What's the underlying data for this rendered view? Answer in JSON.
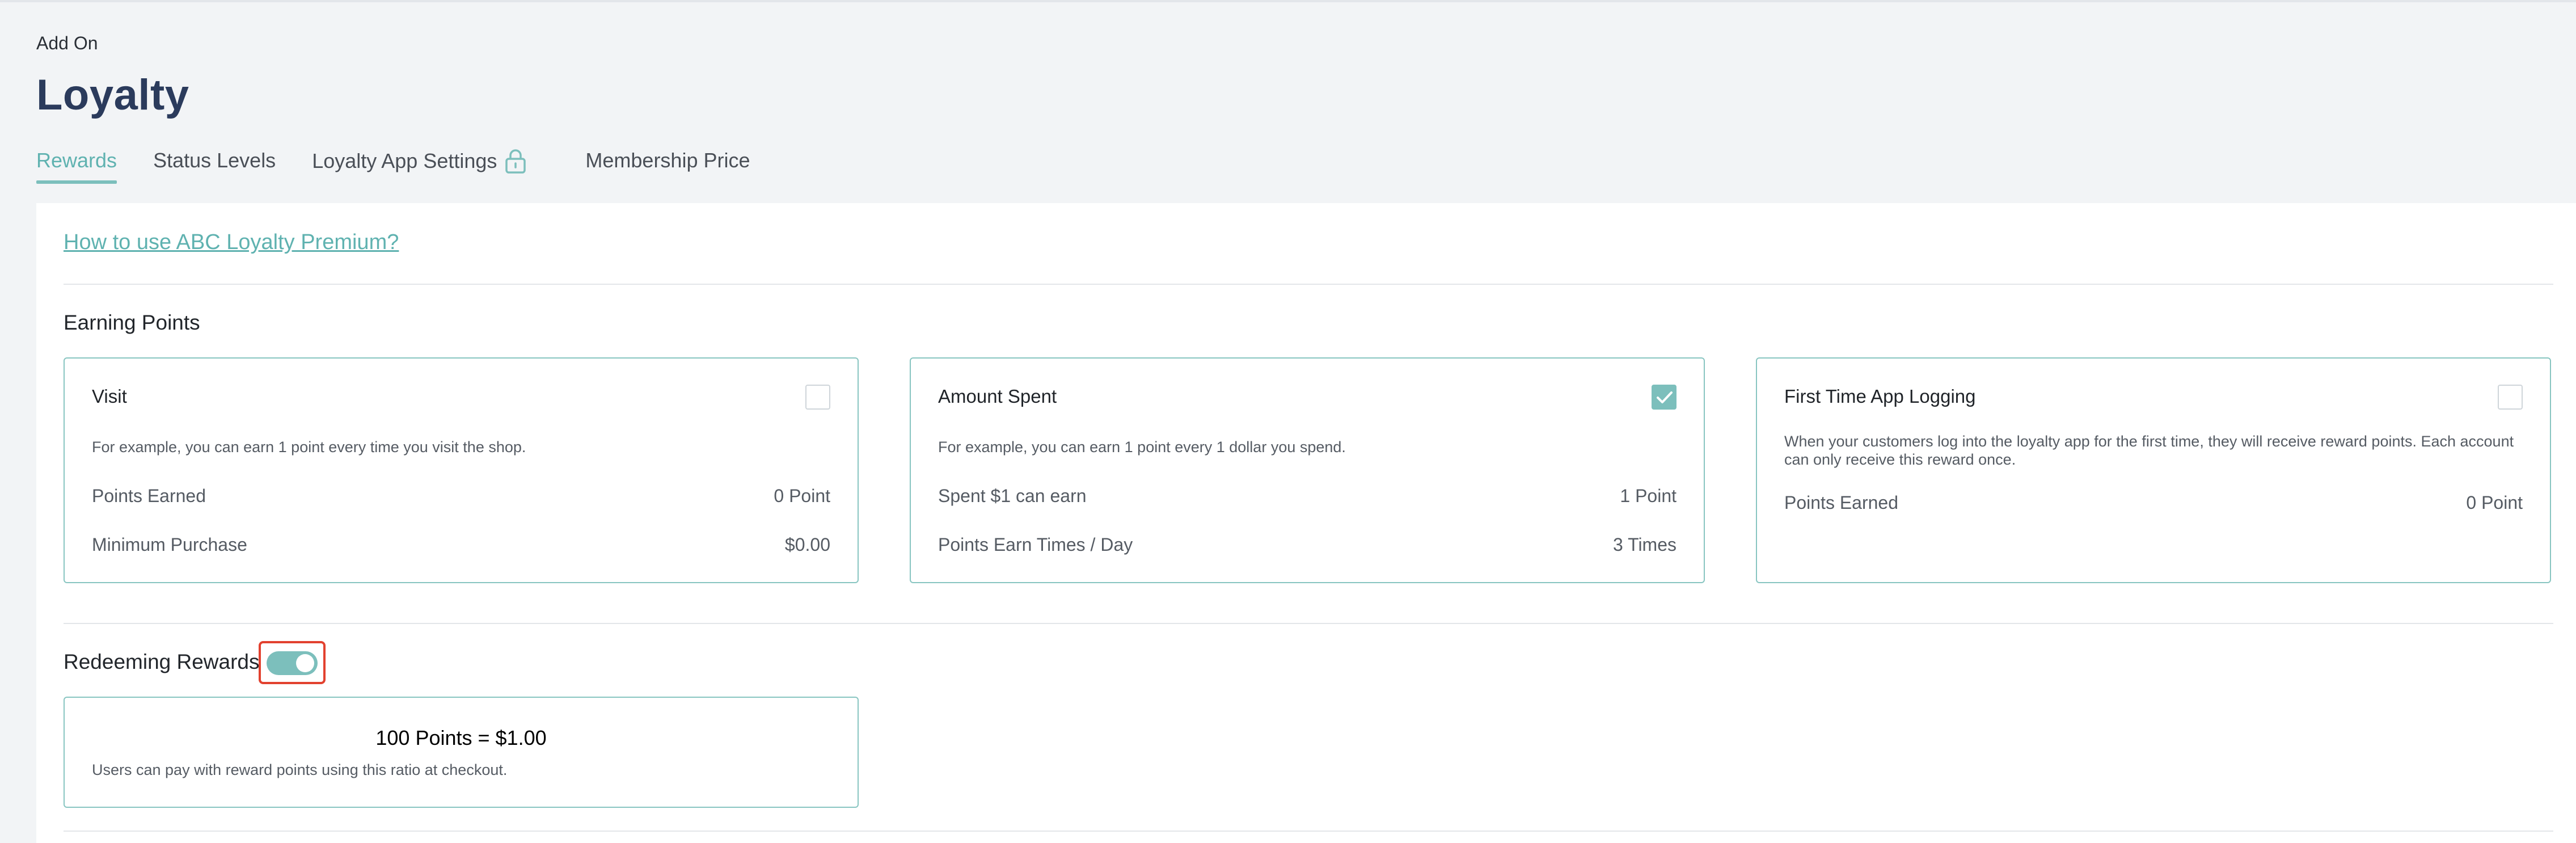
{
  "breadcrumb": "Add On",
  "page_title": "Loyalty",
  "tabs": [
    {
      "label": "Rewards",
      "active": true
    },
    {
      "label": "Status Levels",
      "active": false
    },
    {
      "label": "Loyalty App Settings",
      "active": false,
      "icon": "lock-icon"
    },
    {
      "label": "Membership Price",
      "active": false
    }
  ],
  "help_link": "How to use ABC Loyalty Premium?",
  "earning": {
    "title": "Earning Points",
    "cards": [
      {
        "title": "Visit",
        "checked": false,
        "description": "For example, you can earn 1 point every time you visit the shop.",
        "rows": [
          {
            "label": "Points Earned",
            "value": "0 Point"
          },
          {
            "label": "Minimum Purchase",
            "value": "$0.00"
          }
        ]
      },
      {
        "title": "Amount Spent",
        "checked": true,
        "description": "For example, you can earn 1 point every 1 dollar you spend.",
        "rows": [
          {
            "label": "Spent $1 can earn",
            "value": "1 Point"
          },
          {
            "label": "Points Earn Times / Day",
            "value": "3 Times"
          }
        ]
      },
      {
        "title": "First Time App Logging",
        "checked": false,
        "description": "When your customers log into the loyalty app for the first time, they will receive reward points. Each account can only receive this reward once.",
        "rows": [
          {
            "label": "Points Earned",
            "value": "0 Point"
          }
        ]
      }
    ]
  },
  "redeeming": {
    "title": "Redeeming Rewards",
    "enabled": true,
    "ratio": "100 Points = $1.00",
    "description": "Users can pay with reward points using this ratio at checkout."
  },
  "colors": {
    "accent": "#7cbfbc",
    "accent_text": "#5fb2b0",
    "title": "#2b3b5c",
    "highlight": "#e2412f"
  }
}
